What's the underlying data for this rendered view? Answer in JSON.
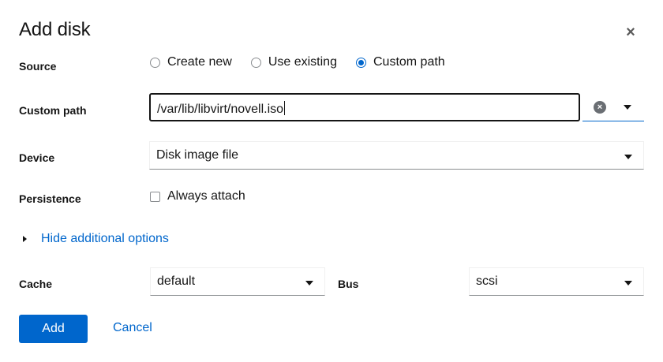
{
  "dialog": {
    "title": "Add disk",
    "close_icon": "×"
  },
  "source": {
    "label": "Source",
    "options": [
      "Create new",
      "Use existing",
      "Custom path"
    ],
    "selected": "Custom path"
  },
  "custom_path": {
    "label": "Custom path",
    "value": "/var/lib/libvirt/novell.iso",
    "clear_icon": "×"
  },
  "device": {
    "label": "Device",
    "value": "Disk image file"
  },
  "persistence": {
    "label": "Persistence",
    "checkbox_label": "Always attach",
    "checked": false
  },
  "additional_options": {
    "toggle_label": "Hide additional options"
  },
  "cache": {
    "label": "Cache",
    "value": "default"
  },
  "bus": {
    "label": "Bus",
    "value": "scsi"
  },
  "actions": {
    "add_label": "Add",
    "cancel_label": "Cancel"
  },
  "colors": {
    "accent": "#0066cc",
    "text": "#151515"
  }
}
